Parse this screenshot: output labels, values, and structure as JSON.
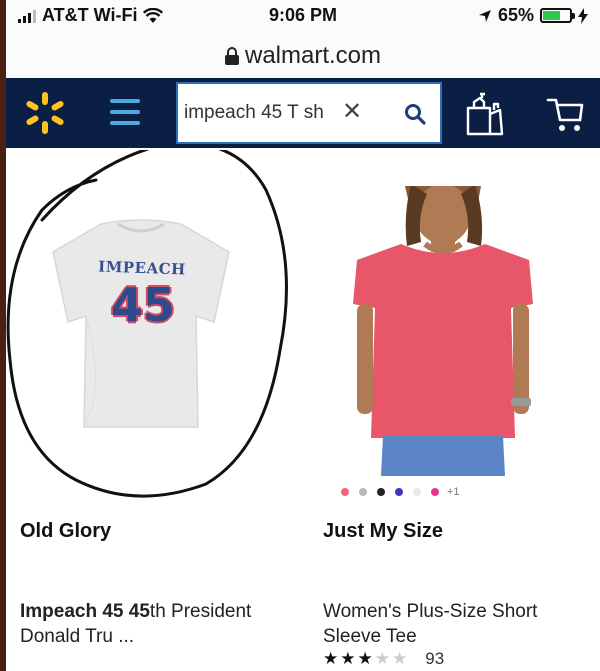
{
  "status_bar": {
    "carrier": "AT&T Wi-Fi",
    "time": "9:06 PM",
    "battery": "65%",
    "battery_level": 0.65
  },
  "browser": {
    "url": "walmart.com"
  },
  "header": {
    "search_value": "impeach 45 T sh",
    "clear_glyph": "✕",
    "icons": [
      "walmart-spark-icon",
      "menu-icon",
      "search-icon",
      "grocery-bag-icon",
      "cart-icon"
    ],
    "colors": {
      "bar": "#0b1f44",
      "spark": "#ffc220",
      "menu": "#4ea8e3"
    }
  },
  "products": [
    {
      "brand": "Old Glory",
      "title_bold": "Impeach 45 45",
      "title_rest": "th President Donald Tru ...",
      "shirt_print_top": "IMPEACH",
      "shirt_print_number": "45"
    },
    {
      "brand": "Just My Size",
      "title": "Women's Plus-Size Short Sleeve Tee",
      "swatch_colors": [
        "#e8687c",
        "#b9b9b9",
        "#222222",
        "#3a3ab8",
        "#e8e8e8",
        "#e03a8c"
      ],
      "swatch_more": "+1",
      "rating": 3,
      "rating_max": 5,
      "review_count": "93"
    }
  ]
}
